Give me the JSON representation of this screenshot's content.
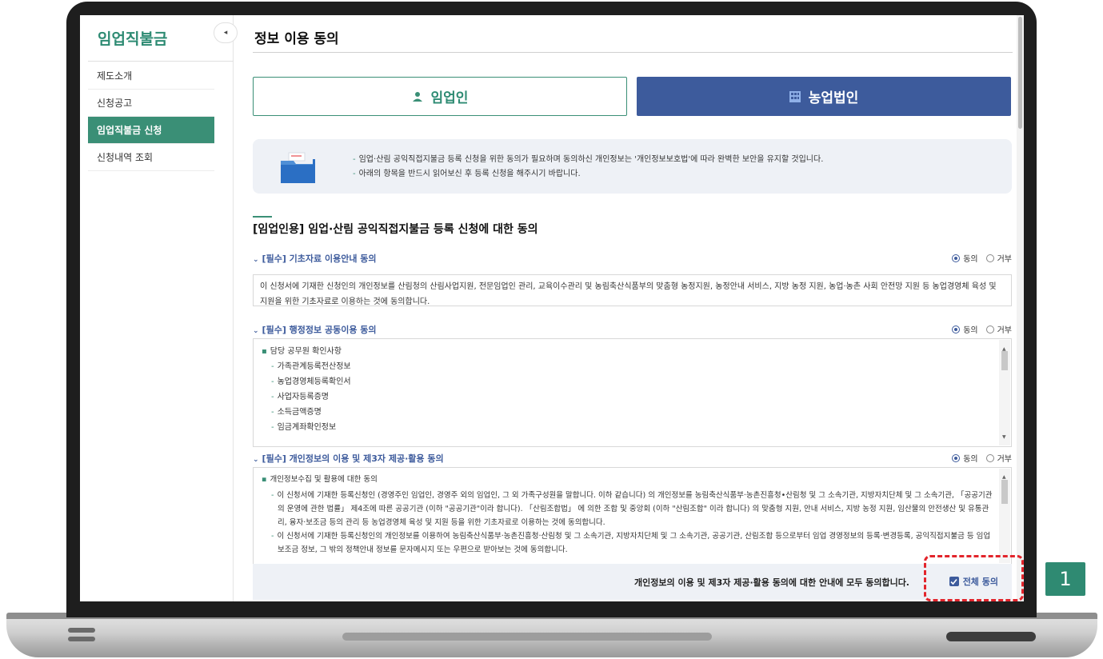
{
  "sidebar": {
    "title": "임업직불금",
    "toggle_glyph": "◂",
    "items": [
      {
        "label": "제도소개",
        "active": false
      },
      {
        "label": "신청공고",
        "active": false
      },
      {
        "label": "임업직불금 신청",
        "active": true
      },
      {
        "label": "신청내역 조회",
        "active": false
      }
    ]
  },
  "main": {
    "title": "정보 이용 동의",
    "type_buttons": {
      "person_label": "임업인",
      "corp_label": "농업법인"
    },
    "info_lines": [
      "임업·산림 공익직접지불금 등록 신청을 위한 동의가 필요하며 동의하신 개인정보는 '개인정보보호법'에 따라 완벽한 보안을 유지할 것입니다.",
      "아래의 항목을 반드시 읽어보신 후 등록 신청을 해주시기 바랍니다."
    ],
    "section_title": "[임업인용] 임업·산림 공익직접지불금 등록 신청에 대한 동의",
    "agreements": [
      {
        "label": "[필수] 기초자료 이용안내 동의",
        "agree": "동의",
        "refuse": "거부",
        "text": "이 신청서에 기재한 신청인의 개인정보를 산림청의 산림사업지원, 전문임업인 관리, 교육이수관리 및 농림축산식품부의 맞춤형 농정지원, 농정안내 서비스, 지방 농정 지원, 농업·농촌 사회 안전망 지원 등 농업경영체 육성 및 지원을 위한 기초자료로 이용하는 것에 동의합니다."
      },
      {
        "label": "[필수] 행정정보 공동이용 동의",
        "agree": "동의",
        "refuse": "거부",
        "heading": "담당 공무원 확인사항",
        "items": [
          "가족관계등록전산정보",
          "농업경영체등록확인서",
          "사업자등록증명",
          "소득금액증명",
          "임금계좌확인정보"
        ]
      },
      {
        "label": "[필수] 개인정보의 이용 및 제3자 제공·활용 동의",
        "agree": "동의",
        "refuse": "거부",
        "heading": "개인정보수집 및 활용에 대한 동의",
        "paras": [
          "이 신청서에 기재한 등록신청인 (경영주인 임업인, 경영주 외의 임업인, 그 외 가족구성원을 말합니다. 이하 같습니다) 의 개인정보를 농림축산식품부·농촌진흥청•산림청 및 그 소속기관, 지방자치단체 및 그 소속기관, 「공공기관의 운영에 관한 법률」 제4조에 따른 공공기관 (이하 \"공공기관\"이라 합니다). 「산림조합법」 에 의한 조합 및 중앙회 (이하 \"산림조합\" 이라 합니다) 의 맞춤형 지원, 안내 서비스, 지방 농정 지원, 임산물의 안전생산 및 유통관리, 융자·보조금 등의 관리 등 농업경영체 육성 및 지원 등을 위한 기초자료로 이용하는 것에 동의합니다.",
          "이 신청서에 기재한 등록신청인의 개인정보를 이용하여 농림축산식품부·농촌진흥청·산림청 및 그 소속기관, 지방자치단체 및 그 소속기관, 공공기관, 산림조합 등으로부터 임업 경영정보의 등록·변경등록, 공익직접지불금 등 임업보조금 정보, 그 밖의 정책안내 정보를 문자메시지 또는 우편으로 받아보는 것에 동의합니다."
        ]
      }
    ],
    "all_agree": {
      "text": "개인정보의 이용 및 제3자 제공·활용 동의에 대한 안내에 모두 동의합니다.",
      "check_label": "전체 동의",
      "checked": true
    }
  },
  "callout": {
    "number": "1"
  },
  "colors": {
    "accent_green": "#3a8f76",
    "accent_blue": "#3d5b9c",
    "callout_red": "#e2242b"
  }
}
